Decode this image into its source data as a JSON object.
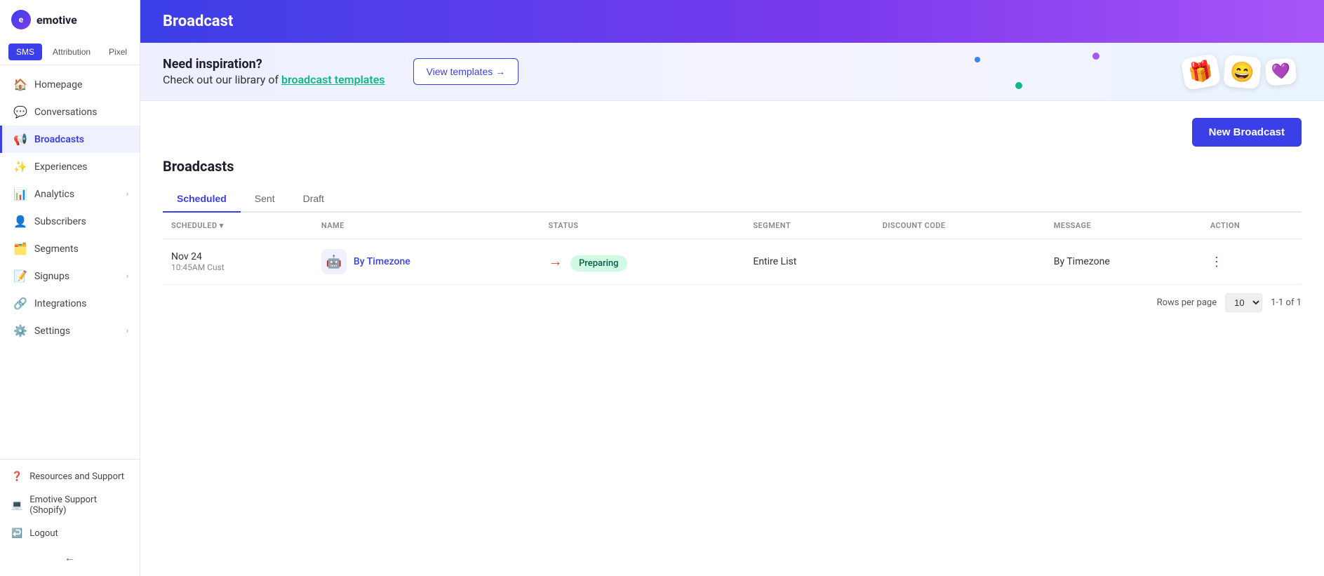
{
  "sidebar": {
    "logo_text": "emotive",
    "tabs": [
      {
        "label": "SMS",
        "active": true
      },
      {
        "label": "Attribution",
        "active": false
      },
      {
        "label": "Pixel",
        "active": false
      }
    ],
    "nav_items": [
      {
        "label": "Homepage",
        "icon": "🏠",
        "active": false,
        "has_arrow": false
      },
      {
        "label": "Conversations",
        "icon": "💬",
        "active": false,
        "has_arrow": false
      },
      {
        "label": "Broadcasts",
        "icon": "📢",
        "active": true,
        "has_arrow": false
      },
      {
        "label": "Experiences",
        "icon": "✨",
        "active": false,
        "has_arrow": false
      },
      {
        "label": "Analytics",
        "icon": "📊",
        "active": false,
        "has_arrow": true
      },
      {
        "label": "Subscribers",
        "icon": "👤",
        "active": false,
        "has_arrow": false
      },
      {
        "label": "Segments",
        "icon": "🗂️",
        "active": false,
        "has_arrow": false
      },
      {
        "label": "Signups",
        "icon": "📝",
        "active": false,
        "has_arrow": true
      },
      {
        "label": "Integrations",
        "icon": "🔗",
        "active": false,
        "has_arrow": false
      },
      {
        "label": "Settings",
        "icon": "⚙️",
        "active": false,
        "has_arrow": true
      }
    ],
    "bottom_items": [
      {
        "label": "Resources and Support",
        "icon": "❓"
      },
      {
        "label": "Emotive Support (Shopify)",
        "icon": "💻"
      },
      {
        "label": "Logout",
        "icon": "↩️"
      }
    ],
    "collapse_label": "←"
  },
  "header": {
    "title": "Broadcast"
  },
  "banner": {
    "heading": "Need inspiration?",
    "subtext_prefix": "Check out our library of ",
    "subtext_highlight": "broadcast templates",
    "view_templates_label": "View templates →",
    "emojis": [
      "😄",
      "🎁",
      "💜"
    ]
  },
  "page": {
    "new_broadcast_label": "New Broadcast",
    "section_title": "Broadcasts",
    "tabs": [
      {
        "label": "Scheduled",
        "active": true
      },
      {
        "label": "Sent",
        "active": false
      },
      {
        "label": "Draft",
        "active": false
      }
    ],
    "table_headers": [
      "SCHEDULED ▾",
      "NAME",
      "STATUS",
      "SEGMENT",
      "DISCOUNT CODE",
      "MESSAGE",
      "ACTION"
    ],
    "rows": [
      {
        "scheduled": "Nov 24",
        "scheduled_time": "10:45AM Cust",
        "name": "By Timezone",
        "status": "Preparing",
        "segment": "Entire List",
        "discount_code": "",
        "message": "By Timezone"
      }
    ],
    "pagination": {
      "rows_per_page_label": "Rows per page",
      "rows_per_page_value": "10",
      "count_label": "1-1 of 1"
    }
  }
}
